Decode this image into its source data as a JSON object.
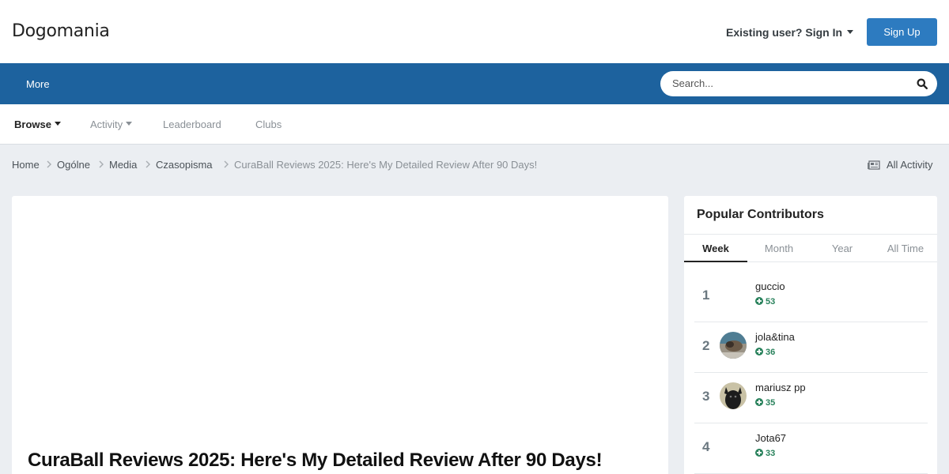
{
  "site": {
    "logo": "Dogomania"
  },
  "header": {
    "signin_label": "Existing user? Sign In",
    "signup_label": "Sign Up"
  },
  "navbar": {
    "more_label": "More",
    "search_placeholder": "Search..."
  },
  "subnav": {
    "items": [
      "Browse",
      "Activity",
      "Leaderboard",
      "Clubs"
    ]
  },
  "breadcrumb": {
    "items": [
      "Home",
      "Ogólne",
      "Media",
      "Czasopisma",
      "CuraBall Reviews 2025: Here's My Detailed Review After 90 Days!"
    ],
    "all_activity": "All Activity"
  },
  "main": {
    "title": "CuraBall Reviews 2025: Here's My Detailed Review After 90 Days!"
  },
  "sidebar": {
    "title": "Popular Contributors",
    "tabs": [
      "Week",
      "Month",
      "Year",
      "All Time"
    ],
    "active_tab": "Week",
    "contributors": [
      {
        "rank": "1",
        "name": "guccio",
        "rep": "53"
      },
      {
        "rank": "2",
        "name": "jola&tina",
        "rep": "36"
      },
      {
        "rank": "3",
        "name": "mariusz pp",
        "rep": "35"
      },
      {
        "rank": "4",
        "name": "Jota67",
        "rep": "33"
      }
    ]
  },
  "colors": {
    "brand_blue": "#1d629e",
    "button_blue": "#2d7bc0",
    "rep_green": "#29825c"
  }
}
